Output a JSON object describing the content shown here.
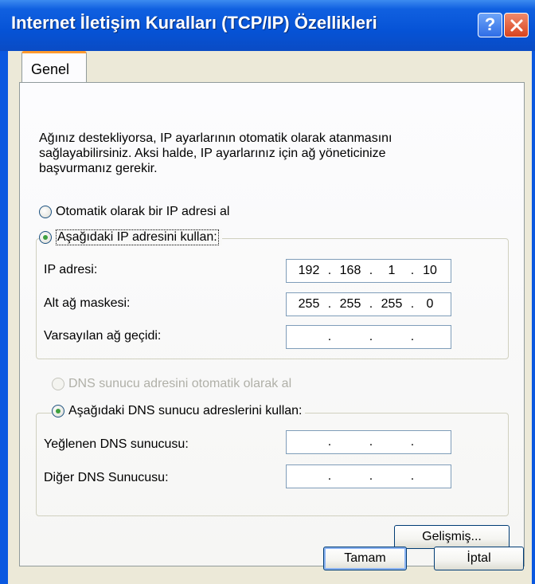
{
  "window": {
    "title": "Internet İletişim Kuralları (TCP/IP) Özellikleri",
    "help_button": "?",
    "close_button": "close"
  },
  "tabs": [
    {
      "label": "Genel",
      "selected": true
    }
  ],
  "description": "Ağınız destekliyorsa, IP ayarlarının otomatik olarak atanmasını sağlayabilirsiniz. Aksi halde, IP ayarlarınız için ağ yöneticinize başvurmanız gerekir.",
  "ip_section": {
    "auto_option": {
      "label": "Otomatik olarak bir IP adresi al",
      "checked": false
    },
    "manual_option": {
      "label": "Aşağıdaki IP adresini kullan:",
      "checked": true
    },
    "fields": [
      {
        "label": "IP adresi:",
        "octets": [
          "192",
          "168",
          "1",
          "10"
        ]
      },
      {
        "label": "Alt ağ maskesi:",
        "octets": [
          "255",
          "255",
          "255",
          "0"
        ]
      },
      {
        "label": "Varsayılan ağ geçidi:",
        "octets": [
          "",
          "",
          "",
          ""
        ]
      }
    ]
  },
  "dns_section": {
    "auto_option": {
      "label": "DNS sunucu adresini otomatik olarak al",
      "checked": false,
      "disabled": true
    },
    "manual_option": {
      "label": "Aşağıdaki DNS sunucu adreslerini kullan:",
      "checked": true
    },
    "fields": [
      {
        "label": "Yeğlenen DNS sunucusu:",
        "octets": [
          "",
          "",
          "",
          ""
        ]
      },
      {
        "label": "Diğer DNS Sunucusu:",
        "octets": [
          "",
          "",
          "",
          ""
        ]
      }
    ]
  },
  "buttons": {
    "advanced": "Gelişmiş...",
    "ok": "Tamam",
    "cancel": "İptal"
  }
}
